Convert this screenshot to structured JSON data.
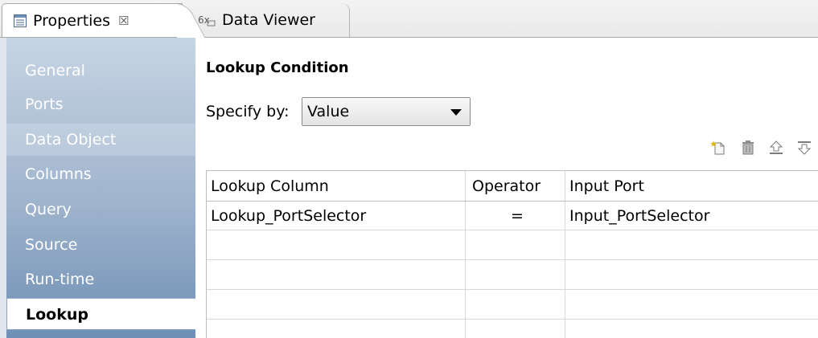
{
  "tabs": [
    {
      "label": "Properties",
      "icon": "properties-icon",
      "close": "☒"
    },
    {
      "label": "Data Viewer",
      "icon": "data-viewer-icon"
    }
  ],
  "sidebar": {
    "items": [
      {
        "label": "General"
      },
      {
        "label": "Ports"
      },
      {
        "label": "Data Object"
      },
      {
        "label": "Columns"
      },
      {
        "label": "Query"
      },
      {
        "label": "Source"
      },
      {
        "label": "Run-time"
      },
      {
        "label": "Lookup"
      }
    ]
  },
  "main": {
    "title": "Lookup Condition",
    "specify_label": "Specify by:",
    "specify_value": "Value"
  },
  "toolbar": {
    "icons": [
      "new-icon",
      "delete-icon",
      "move-up-icon",
      "move-down-icon"
    ]
  },
  "table": {
    "columns": [
      "Lookup Column",
      "Operator",
      "Input Port"
    ],
    "rows": [
      [
        "Lookup_PortSelector",
        "=",
        "Input_PortSelector"
      ]
    ]
  },
  "colors": {
    "sidebar_top": "#c7d4e3",
    "sidebar_bottom": "#6f8fb4",
    "selected_item_bg": "#ffffff"
  }
}
